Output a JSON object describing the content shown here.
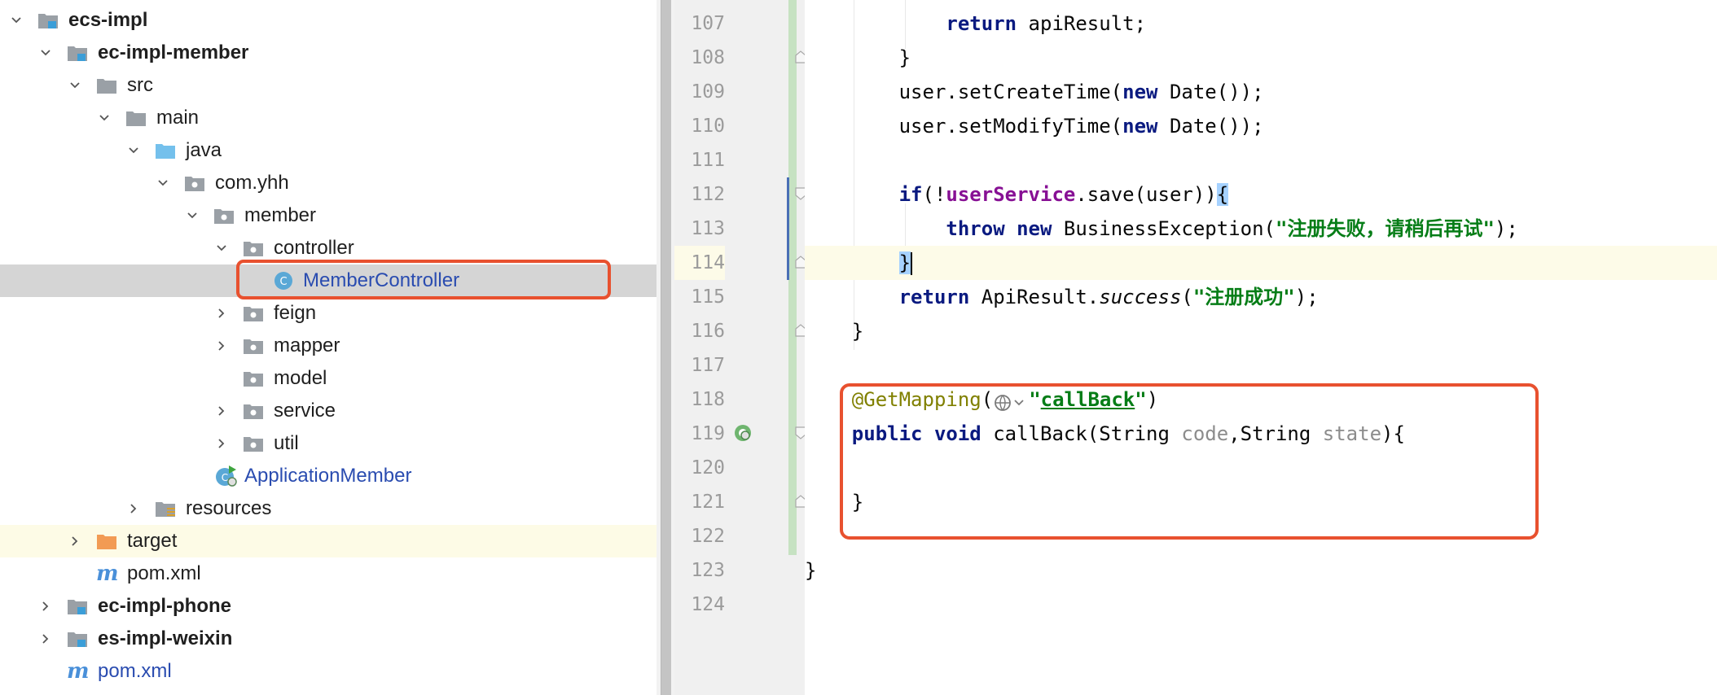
{
  "tree": {
    "rows": [
      {
        "label": "ecs-impl",
        "bold": true,
        "blue": false
      },
      {
        "label": "ec-impl-member",
        "bold": true,
        "blue": false
      },
      {
        "label": "src",
        "bold": false,
        "blue": false
      },
      {
        "label": "main",
        "bold": false,
        "blue": false
      },
      {
        "label": "java",
        "bold": false,
        "blue": false
      },
      {
        "label": "com.yhh",
        "bold": false,
        "blue": false
      },
      {
        "label": "member",
        "bold": false,
        "blue": false
      },
      {
        "label": "controller",
        "bold": false,
        "blue": false
      },
      {
        "label": "MemberController",
        "bold": false,
        "blue": true
      },
      {
        "label": "feign",
        "bold": false,
        "blue": false
      },
      {
        "label": "mapper",
        "bold": false,
        "blue": false
      },
      {
        "label": "model",
        "bold": false,
        "blue": false
      },
      {
        "label": "service",
        "bold": false,
        "blue": false
      },
      {
        "label": "util",
        "bold": false,
        "blue": false
      },
      {
        "label": "ApplicationMember",
        "bold": false,
        "blue": true
      },
      {
        "label": "resources",
        "bold": false,
        "blue": false
      },
      {
        "label": "target",
        "bold": false,
        "blue": false
      },
      {
        "label": "pom.xml",
        "bold": false,
        "blue": false
      },
      {
        "label": "ec-impl-phone",
        "bold": true,
        "blue": false
      },
      {
        "label": "es-impl-weixin",
        "bold": true,
        "blue": false
      },
      {
        "label": "pom.xml",
        "bold": false,
        "blue": true
      }
    ],
    "selected_item": "MemberController"
  },
  "editor": {
    "line_numbers": [
      "107",
      "108",
      "109",
      "110",
      "111",
      "112",
      "113",
      "114",
      "115",
      "116",
      "117",
      "118",
      "119",
      "120",
      "121",
      "122",
      "123",
      "124"
    ],
    "current_line": "114",
    "code": {
      "l107": {
        "kw_return": "return",
        "rest": " apiResult;"
      },
      "l108": {
        "text": "}"
      },
      "l109": {
        "a": "user.setCreateTime(",
        "kw_new": "new",
        "b": " Date());"
      },
      "l110": {
        "a": "user.setModifyTime(",
        "kw_new": "new",
        "b": " Date());"
      },
      "l112": {
        "kw_if": "if",
        "a": "(!",
        "field": "userService",
        "b": ".save(user))",
        "brace": "{"
      },
      "l113": {
        "kw_throw": "throw",
        "kw_new": "new",
        "a": " BusinessException(",
        "str": "\"注册失败，请稍后再试\"",
        "b": ");"
      },
      "l114": {
        "brace": "}"
      },
      "l115": {
        "kw_return": "return",
        "a": " ApiResult.",
        "method": "success",
        "b": "(",
        "str": "\"注册成功\"",
        "c": ");"
      },
      "l116": {
        "text": "}"
      },
      "l118": {
        "annotation": "@GetMapping",
        "open": "(",
        "q1": "\"",
        "path": "callBack",
        "q2": "\"",
        "close": ")"
      },
      "l119": {
        "kw_public": "public",
        "kw_void": "void",
        "a": " callBack(String ",
        "p1": "code",
        "b": ",String ",
        "p2": "state",
        "c": "){"
      },
      "l121": {
        "text": "}"
      },
      "l123": {
        "text": "}"
      }
    }
  },
  "colors": {
    "highlight_box": "#e8512f",
    "keyword": "#0a1a80",
    "string": "#067d17",
    "field": "#871094",
    "annotation": "#808000"
  },
  "icons": [
    "chevron-down-icon",
    "chevron-right-icon",
    "module-icon",
    "folder-icon",
    "source-folder-icon",
    "package-icon",
    "class-icon",
    "spring-boot-class-icon",
    "resources-folder-icon",
    "excluded-folder-icon",
    "maven-icon",
    "fold-marker-icon",
    "lightbulb-icon",
    "spring-bean-icon",
    "url-mapping-icon"
  ]
}
